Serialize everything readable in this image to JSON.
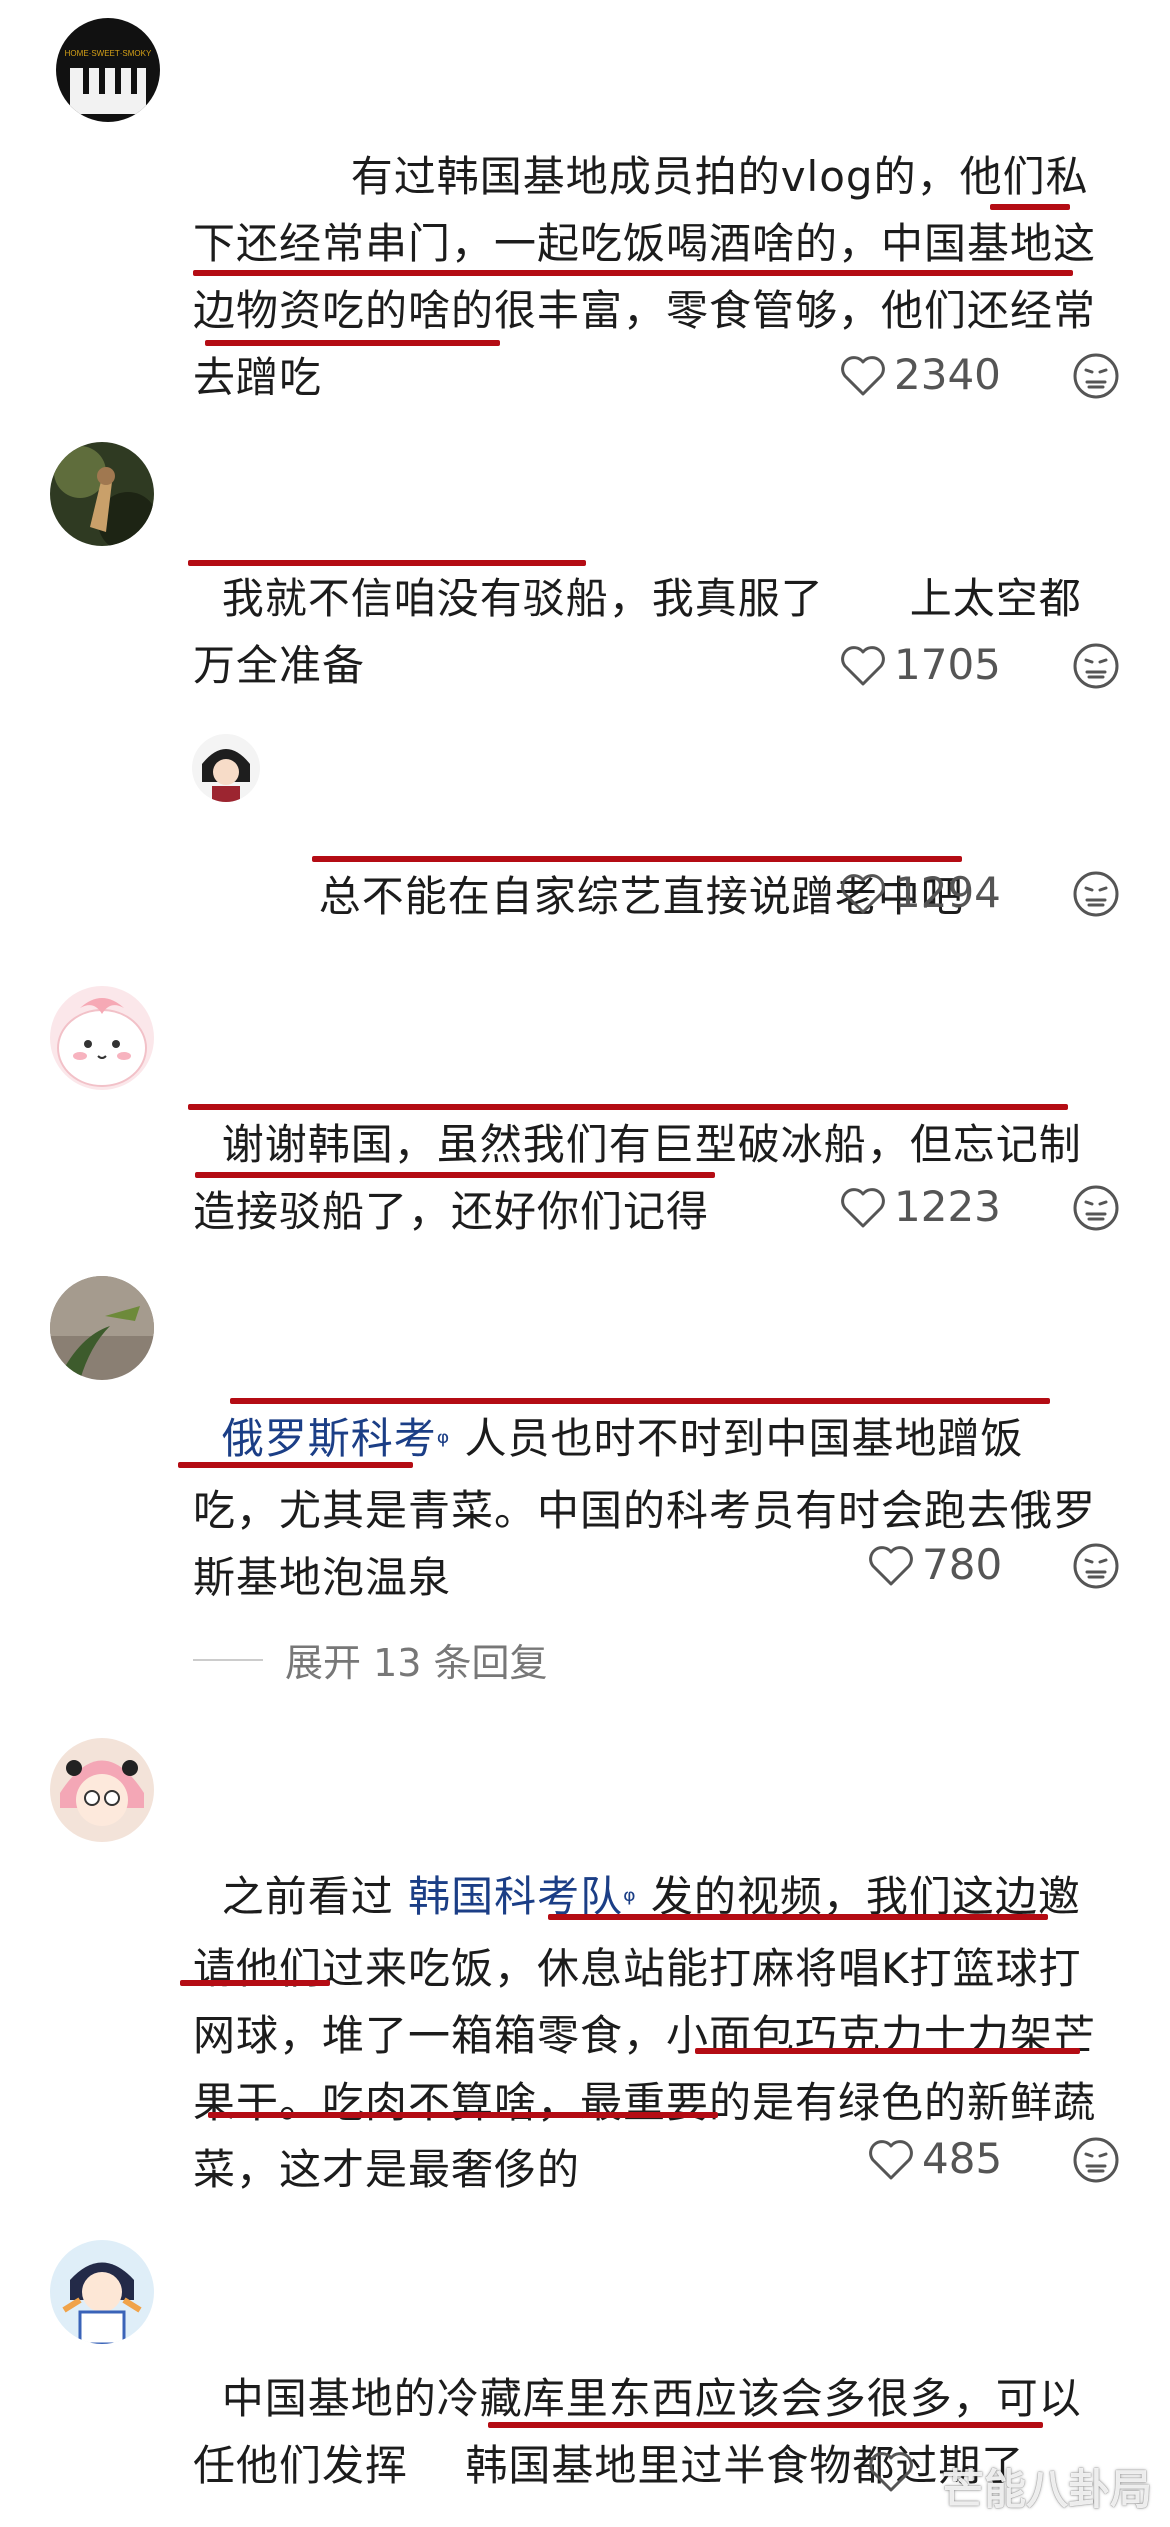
{
  "comments": [
    {
      "segments": [
        {
          "text": "　　　有过韩国基地成员拍的vlog的，他们私下还经常串门，一起吃饭喝酒啥的，中国基地这边物资吃的啥的很丰富，零食管够，他们还经常去蹭吃"
        }
      ],
      "likes": "2340"
    },
    {
      "segments": [
        {
          "text": "我就不信咱没有驳船，我真服了　　上太空都万全准备"
        }
      ],
      "likes": "1705"
    },
    {
      "segments": [
        {
          "text": "总不能在自家综艺直接说蹭老中吧"
        }
      ],
      "likes": "1294"
    },
    {
      "segments": [
        {
          "text": "谢谢韩国，虽然我们有巨型破冰船，但忘记制造接驳船了，还好你们记得"
        }
      ],
      "likes": "1223"
    },
    {
      "segments": [
        {
          "text": "俄罗斯科考",
          "link": true
        },
        {
          "text": " 人员也时不时到中国基地蹭饭吃，尤其是青菜。中国的科考员有时会跑去俄罗斯基地泡温泉"
        }
      ],
      "likes": "780"
    },
    {
      "segments": [
        {
          "text": "之前看过 "
        },
        {
          "text": "韩国科考队",
          "link": true
        },
        {
          "text": " 发的视频，我们这边邀请他们过来吃饭，休息站能打麻将唱K打篮球打网球，堆了一箱箱零食，小面包巧克力士力架芒果干。吃肉不算啥，最重要的是有绿色的新鲜蔬菜，这才是最奢侈的"
        }
      ],
      "likes": "485"
    },
    {
      "segments": [
        {
          "text": "中国基地的冷藏库里东西应该会多很多，可以任他们发挥　 韩国基地里过半食物都过期了"
        }
      ],
      "likes": ""
    }
  ],
  "expand_replies": "展开 13 条回复",
  "avatar_1_logo": "HOME·SWEET·SMOKY",
  "watermark": "芒能八卦局",
  "colors": {
    "underline": "#b40c14",
    "link": "#1b3e86",
    "meta": "#555555"
  },
  "icons": {
    "like": "heart-outline-icon",
    "dislike": "unhappy-face-icon"
  }
}
